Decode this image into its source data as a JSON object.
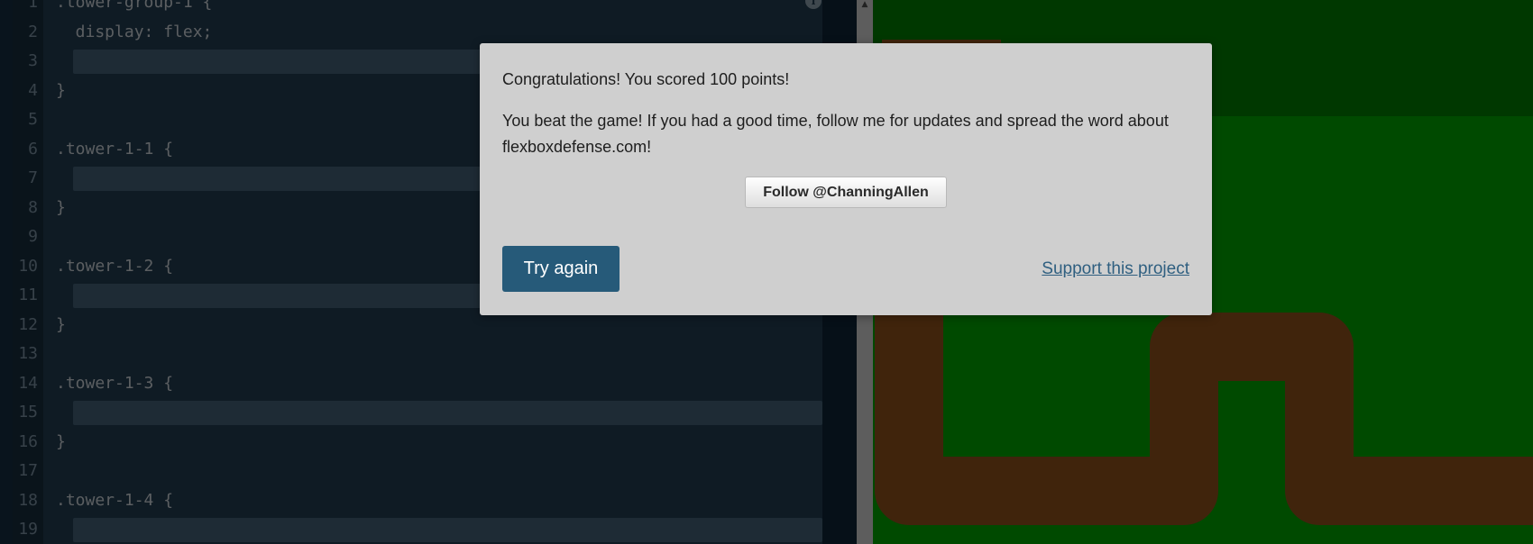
{
  "editor": {
    "lines": [
      {
        "num": "1",
        "text": ".tower-group-1 {",
        "input": false
      },
      {
        "num": "2",
        "text": "  display: flex;",
        "input": false
      },
      {
        "num": "3",
        "text": "",
        "input": true
      },
      {
        "num": "4",
        "text": "}",
        "input": false
      },
      {
        "num": "5",
        "text": "",
        "input": false
      },
      {
        "num": "6",
        "text": ".tower-1-1 {",
        "input": false
      },
      {
        "num": "7",
        "text": "",
        "input": true
      },
      {
        "num": "8",
        "text": "}",
        "input": false
      },
      {
        "num": "9",
        "text": "",
        "input": false
      },
      {
        "num": "10",
        "text": ".tower-1-2 {",
        "input": false
      },
      {
        "num": "11",
        "text": "",
        "input": true
      },
      {
        "num": "12",
        "text": "}",
        "input": false
      },
      {
        "num": "13",
        "text": "",
        "input": false
      },
      {
        "num": "14",
        "text": ".tower-1-3 {",
        "input": false
      },
      {
        "num": "15",
        "text": "",
        "input": true
      },
      {
        "num": "16",
        "text": "}",
        "input": false
      },
      {
        "num": "17",
        "text": "",
        "input": false
      },
      {
        "num": "18",
        "text": ".tower-1-4 {",
        "input": false
      },
      {
        "num": "19",
        "text": "",
        "input": true
      }
    ],
    "info_icon": "info-icon"
  },
  "modal": {
    "score_text": "Congratulations! You scored 100 points!",
    "beat_text": "You beat the game! If you had a good time, follow me for updates and spread the word about flexboxdefense.com!",
    "follow_label": "Follow @ChanningAllen",
    "try_again_label": "Try again",
    "support_label": "Support this project"
  },
  "colors": {
    "try_again": "#265a79",
    "support_link": "#2f5f80",
    "board_grass": "#00b800",
    "board_path": "#a05a1e"
  }
}
